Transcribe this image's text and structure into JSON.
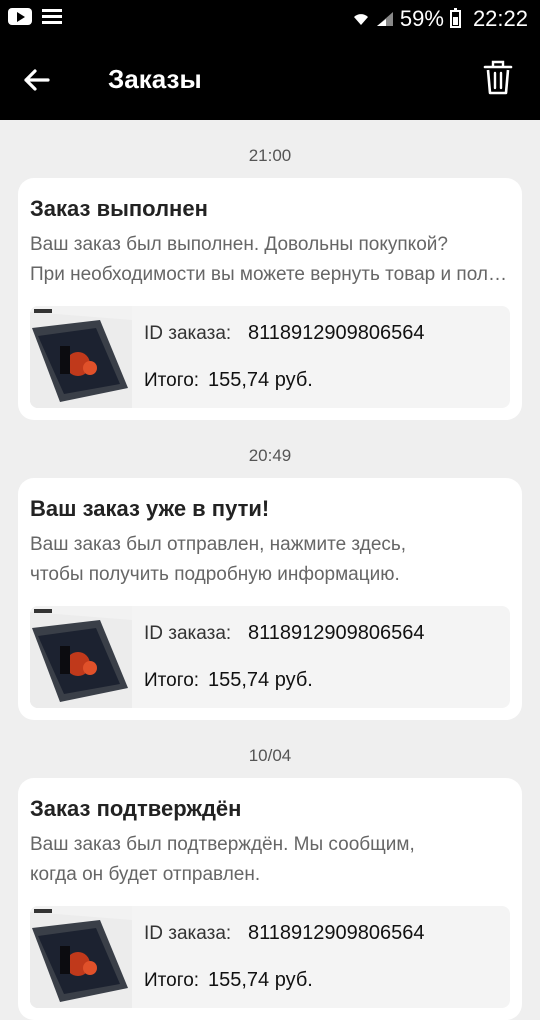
{
  "status_bar": {
    "battery": "59%",
    "time": "22:22"
  },
  "app_bar": {
    "title": "Заказы"
  },
  "notifications": [
    {
      "date": "21:00",
      "title": "Заказ выполнен",
      "text_line1": "Ваш заказ был выполнен. Довольны покупкой?",
      "text_line2": "При необходимости вы можете вернуть товар и получить возврат средств.",
      "order_id_label": "ID заказа:",
      "order_id": "8118912909806564",
      "total_label": "Итого:",
      "total": "155,74 руб."
    },
    {
      "date": "20:49",
      "title": "Ваш заказ уже в пути!",
      "text_line1": "Ваш заказ был отправлен, нажмите здесь,",
      "text_line2": "чтобы получить подробную информацию.",
      "order_id_label": "ID заказа:",
      "order_id": "8118912909806564",
      "total_label": "Итого:",
      "total": "155,74 руб."
    },
    {
      "date": "10/04",
      "title": "Заказ подтверждён",
      "text_line1": "Ваш заказ был подтверждён. Мы сообщим,",
      "text_line2": "когда он будет отправлен.",
      "order_id_label": "ID заказа:",
      "order_id": "8118912909806564",
      "total_label": "Итого:",
      "total": "155,74 руб."
    }
  ]
}
